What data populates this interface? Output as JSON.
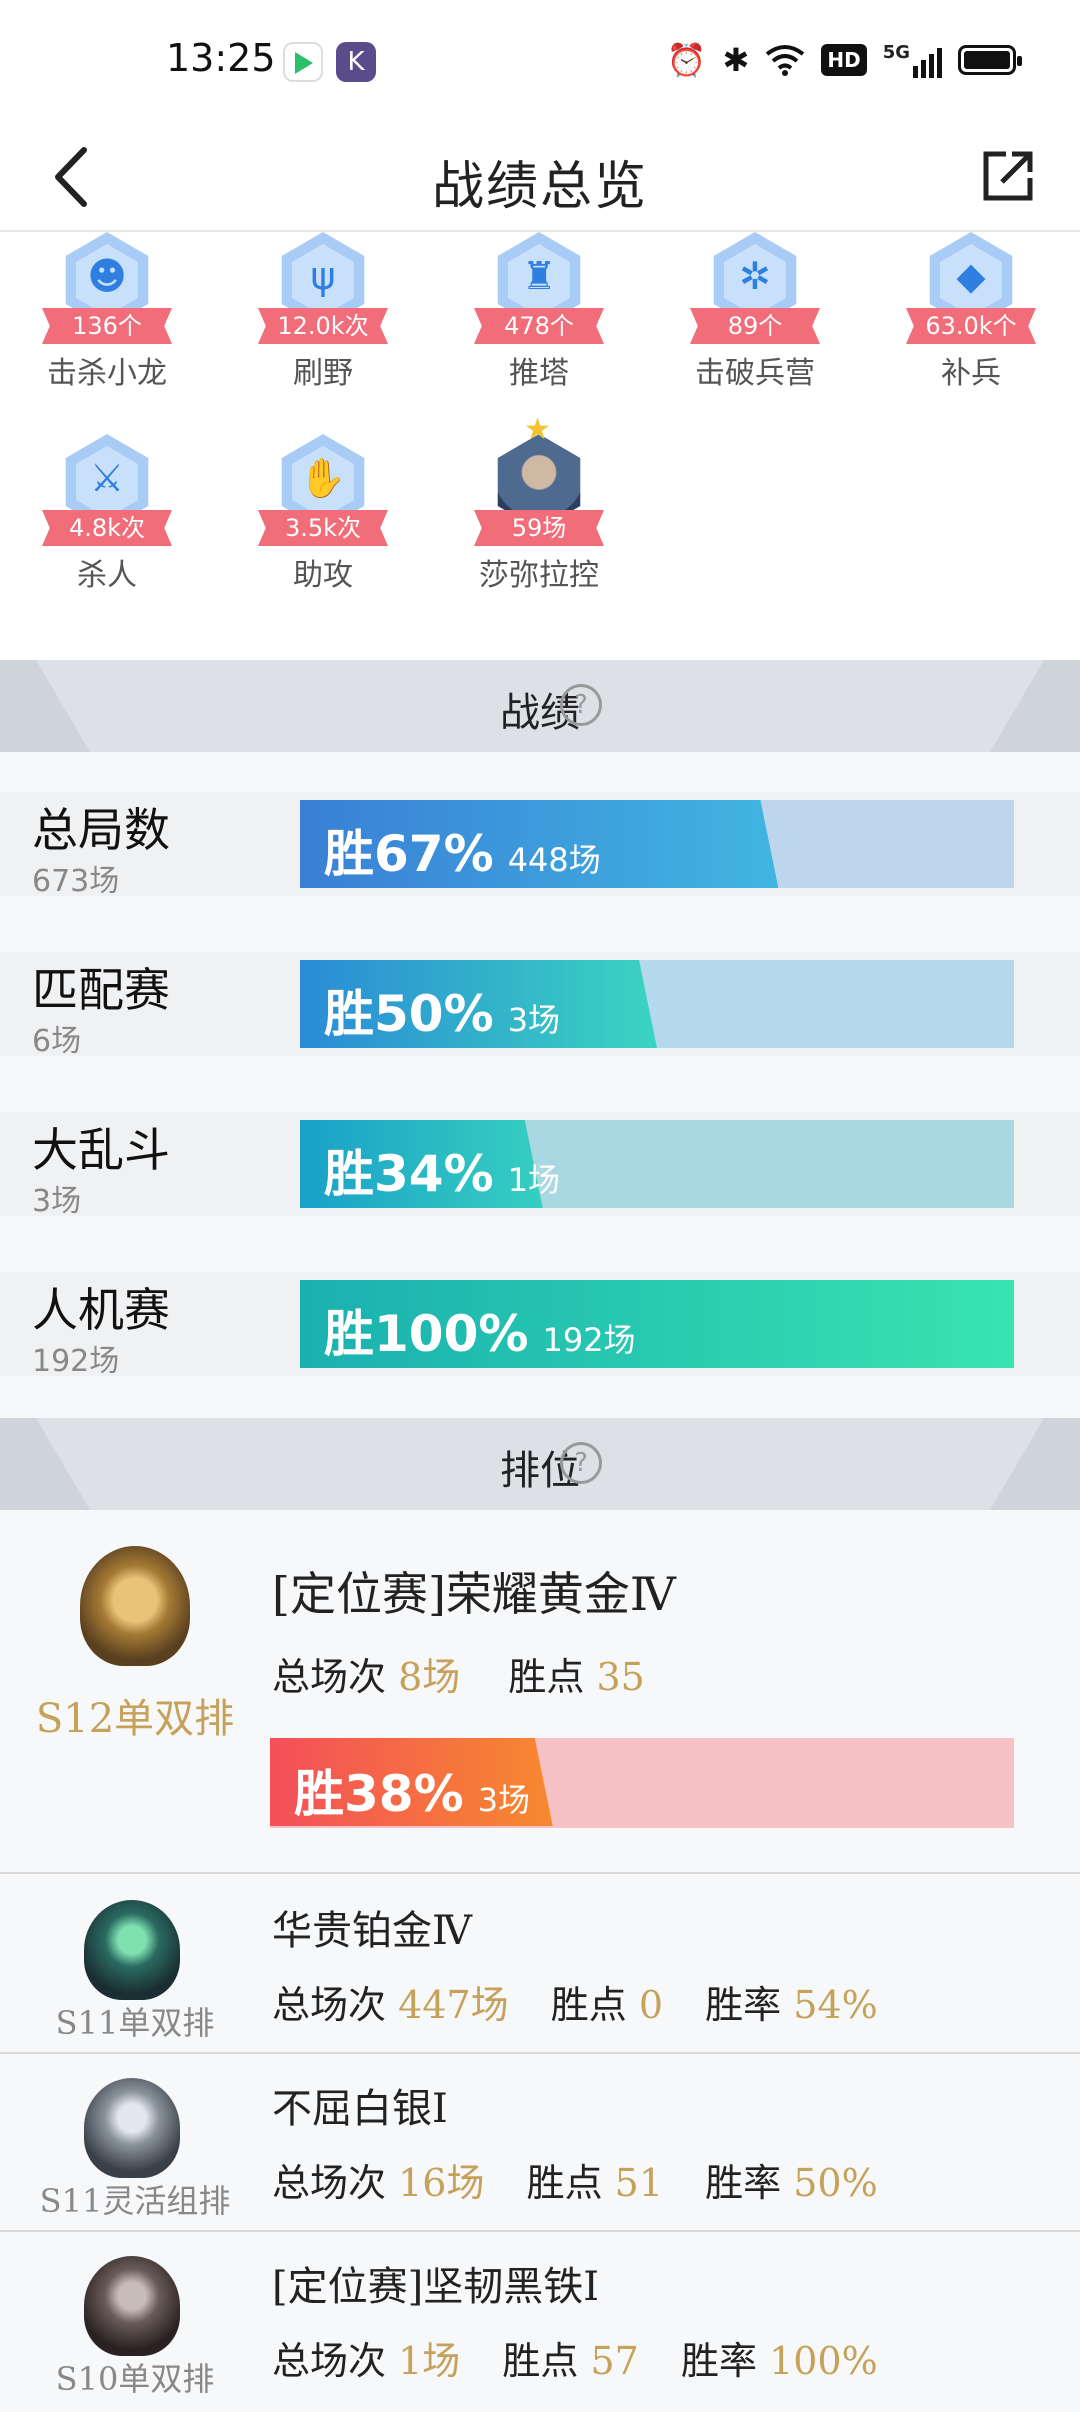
{
  "status_bar": {
    "time": "13:25",
    "app_icons": [
      "video-app-icon",
      "k-app-icon"
    ],
    "k_letter": "K",
    "indicators": [
      "alarm-icon",
      "bluetooth-icon",
      "wifi-icon",
      "hd-icon",
      "5g-signal-icon",
      "battery-icon"
    ],
    "hd_text": "HD",
    "signal_text": "5G"
  },
  "nav": {
    "title": "战绩总览",
    "back_icon": "back-arrow-icon",
    "share_icon": "share-icon"
  },
  "stats": [
    {
      "icon": "dragon-icon",
      "value": "136个",
      "label": "击杀小龙"
    },
    {
      "icon": "jungle-icon",
      "value": "12.0k次",
      "label": "刷野"
    },
    {
      "icon": "tower-icon",
      "value": "478个",
      "label": "推塔"
    },
    {
      "icon": "barracks-icon",
      "value": "89个",
      "label": "击破兵营"
    },
    {
      "icon": "minion-icon",
      "value": "63.0k个",
      "label": "补兵"
    },
    {
      "icon": "kill-icon",
      "value": "4.8k次",
      "label": "杀人"
    },
    {
      "icon": "assist-icon",
      "value": "3.5k次",
      "label": "助攻"
    },
    {
      "icon": "champion-portrait",
      "value": "59场",
      "label": "莎弥拉控"
    }
  ],
  "record_section": {
    "title": "战绩"
  },
  "records": [
    {
      "name": "总局数",
      "count": "673场",
      "win_pct": "胜67%",
      "wins": "448场",
      "fill": 0.67,
      "bg": "#bdd6ee",
      "grad_from": "#3a7fd6",
      "grad_to": "#40b6e0"
    },
    {
      "name": "匹配赛",
      "count": "6场",
      "win_pct": "胜50%",
      "wins": "3场",
      "fill": 0.5,
      "bg": "#b4d9ec",
      "grad_from": "#2a8bd6",
      "grad_to": "#3ad4c0"
    },
    {
      "name": "大乱斗",
      "count": "3场",
      "win_pct": "胜34%",
      "wins": "1场",
      "fill": 0.34,
      "bg": "#a9d8e3",
      "grad_from": "#1aa0c8",
      "grad_to": "#36cfc0"
    },
    {
      "name": "人机赛",
      "count": "192场",
      "win_pct": "胜100%",
      "wins": "192场",
      "fill": 1.0,
      "bg": "#b0e4dc",
      "grad_from": "#1ab0b0",
      "grad_to": "#38e4b0"
    }
  ],
  "ranked_section": {
    "title": "排位"
  },
  "ranked_main": {
    "season": "S12单双排",
    "rank": "[定位赛]荣耀黄金Ⅳ",
    "total_label": "总场次",
    "total": "8场",
    "points_label": "胜点",
    "points": "35",
    "win_pct": "胜38%",
    "wins": "3场",
    "fill": 0.38,
    "bg": "#f7c2c5",
    "grad_from": "#f44f5a",
    "grad_to": "#f7892e"
  },
  "ranked_history": [
    {
      "season": "S11单双排",
      "rank": "华贵铂金Ⅳ",
      "total_label": "总场次",
      "total": "447场",
      "points_label": "胜点",
      "points": "0",
      "rate_label": "胜率",
      "rate": "54%",
      "color": "#2a6b62"
    },
    {
      "season": "S11灵活组排",
      "rank": "不屈白银Ⅰ",
      "total_label": "总场次",
      "total": "16场",
      "points_label": "胜点",
      "points": "51",
      "rate_label": "胜率",
      "rate": "50%",
      "color": "#6c7480"
    },
    {
      "season": "S10单双排",
      "rank": "[定位赛]坚韧黑铁Ⅰ",
      "total_label": "总场次",
      "total": "1场",
      "points_label": "胜点",
      "points": "57",
      "rate_label": "胜率",
      "rate": "100%",
      "color": "#4a4040"
    }
  ]
}
